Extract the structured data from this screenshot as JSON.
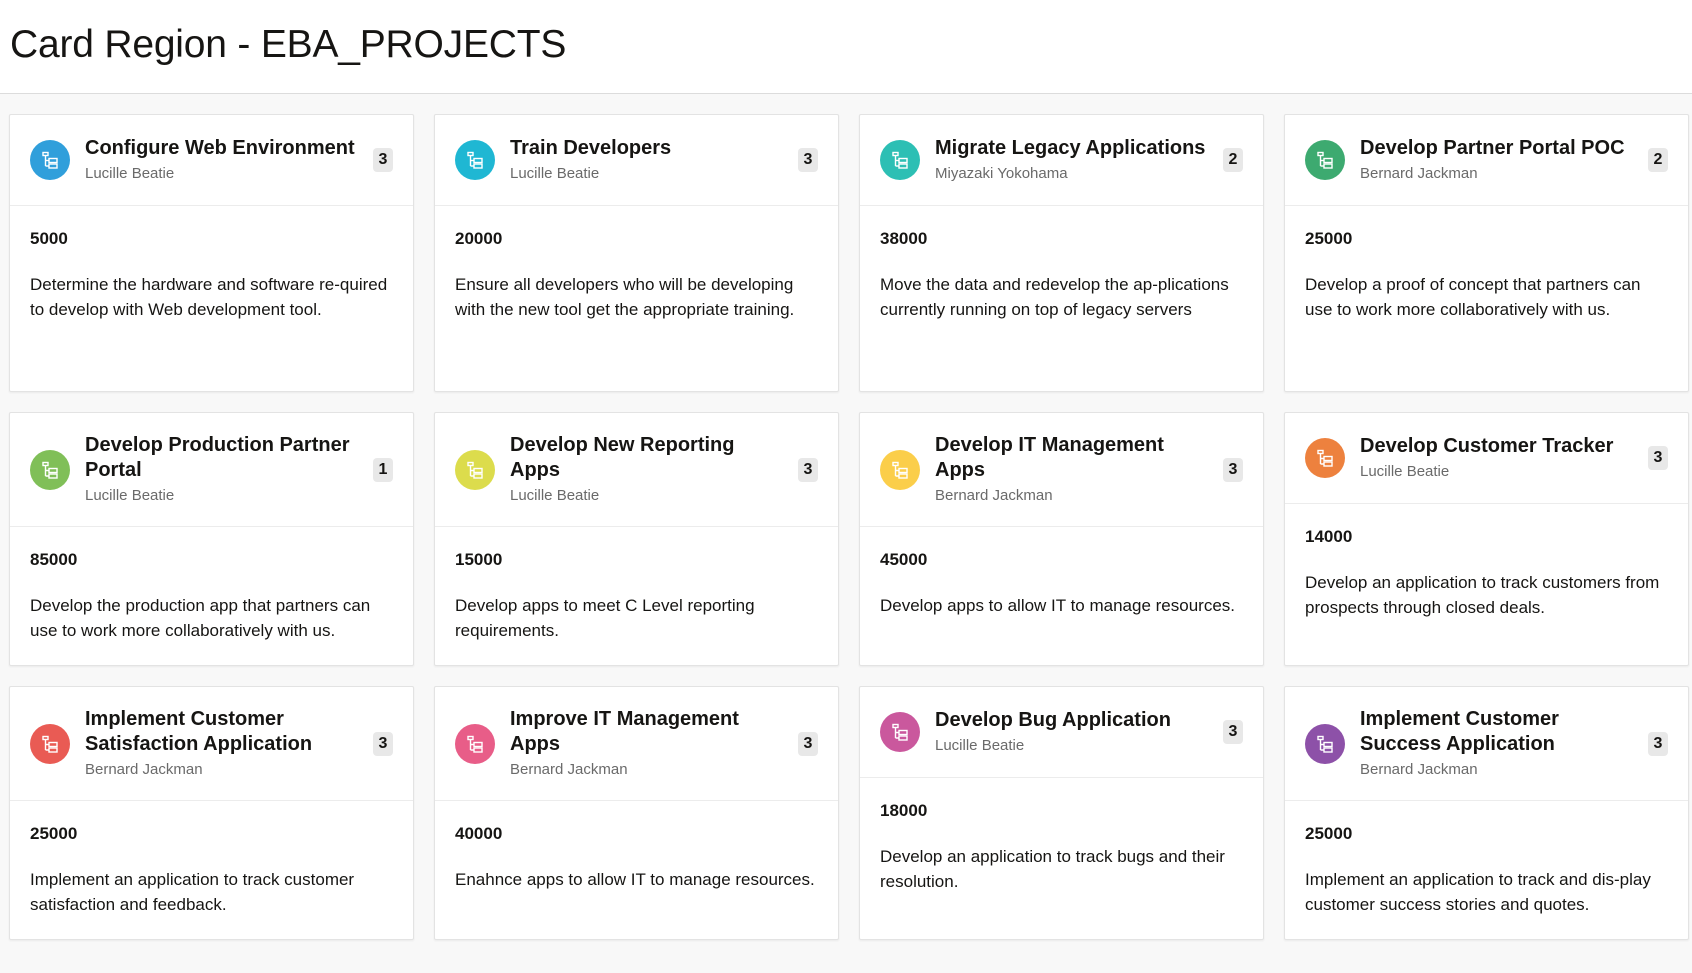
{
  "page": {
    "title": "Card Region - EBA_PROJECTS"
  },
  "cards": [
    {
      "title": "Configure Web Environment",
      "owner": "Lucille Beatie",
      "badge": "3",
      "amount": "5000",
      "description": "Determine the hardware and software re-quired to develop with Web development tool.",
      "color": "#309fdb",
      "icon": "project-icon"
    },
    {
      "title": "Train Developers",
      "owner": "Lucille Beatie",
      "badge": "3",
      "amount": "20000",
      "description": "Ensure all developers who will be developing with the new tool get the appropriate training.",
      "color": "#1fb7d3",
      "icon": "project-icon"
    },
    {
      "title": "Migrate Legacy Applications",
      "owner": "Miyazaki Yokohama",
      "badge": "2",
      "amount": "38000",
      "description": "Move the data and redevelop the ap-plications currently running on top of legacy servers",
      "color": "#2dbfb4",
      "icon": "project-icon"
    },
    {
      "title": "Develop Partner Portal POC",
      "owner": "Bernard Jackman",
      "badge": "2",
      "amount": "25000",
      "description": "Develop a proof of concept that partners can use to work more collaboratively with us.",
      "color": "#3daa70",
      "icon": "project-icon"
    },
    {
      "title": "Develop Production Partner Portal",
      "owner": "Lucille Beatie",
      "badge": "1",
      "amount": "85000",
      "description": "Develop the production app that partners can use to work more collaboratively with us.",
      "color": "#80bf58",
      "icon": "project-icon"
    },
    {
      "title": "Develop New Reporting Apps",
      "owner": "Lucille Beatie",
      "badge": "3",
      "amount": "15000",
      "description": "Develop apps to meet C Level reporting requirements.",
      "color": "#dcdc4c",
      "icon": "project-icon"
    },
    {
      "title": "Develop IT Management Apps",
      "owner": "Bernard Jackman",
      "badge": "3",
      "amount": "45000",
      "description": "Develop apps to allow IT to manage resources.",
      "color": "#fbce4a",
      "icon": "project-icon"
    },
    {
      "title": "Develop Customer Tracker",
      "owner": "Lucille Beatie",
      "badge": "3",
      "amount": "14000",
      "description": "Develop an application to track customers from prospects through closed deals.",
      "color": "#ed813e",
      "icon": "project-icon"
    },
    {
      "title": "Implement Customer Satisfaction Application",
      "owner": "Bernard Jackman",
      "badge": "3",
      "amount": "25000",
      "description": "Implement an application to track customer satisfaction and feedback.",
      "color": "#e95b54",
      "icon": "project-icon"
    },
    {
      "title": "Improve IT Management Apps",
      "owner": "Bernard Jackman",
      "badge": "3",
      "amount": "40000",
      "description": "Enahnce apps to allow IT to manage resources.",
      "color": "#e85d88",
      "icon": "project-icon"
    },
    {
      "title": "Develop Bug Application",
      "owner": "Lucille Beatie",
      "badge": "3",
      "amount": "18000",
      "description": "Develop an application to track bugs and their resolution.",
      "color": "#ca589d",
      "icon": "project-icon"
    },
    {
      "title": "Implement Customer Success Application",
      "owner": "Bernard Jackman",
      "badge": "3",
      "amount": "25000",
      "description": "Implement an application to track and dis-play customer success stories and quotes.",
      "color": "#8d51a8",
      "icon": "project-icon"
    }
  ],
  "colors": {
    "page_bg": "#f8f8f8",
    "card_bg": "#ffffff",
    "badge_bg": "#e8e8e8",
    "subtitle": "#6a6a6a"
  }
}
